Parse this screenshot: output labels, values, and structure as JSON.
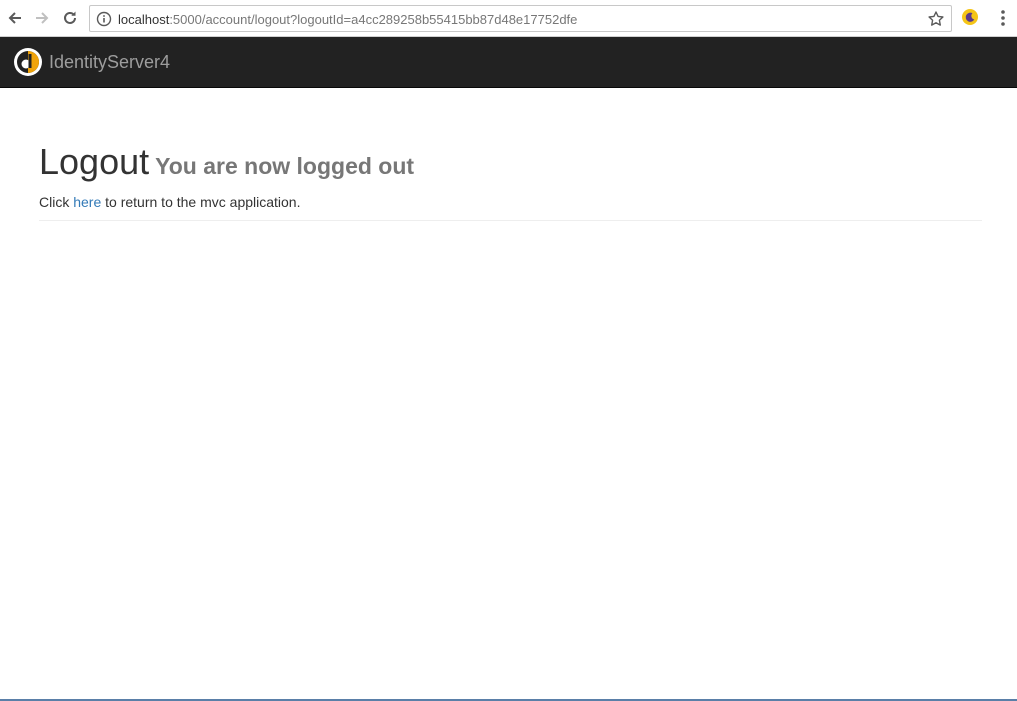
{
  "browser": {
    "url_host": "localhost",
    "url_path": ":5000/account/logout?logoutId=a4cc289258b55415bb87d48e17752dfe"
  },
  "navbar": {
    "brand": "IdentityServer4"
  },
  "page": {
    "title": "Logout",
    "subtitle": "You are now logged out",
    "message_prefix": "Click ",
    "link_text": "here",
    "message_suffix": " to return to the mvc application."
  },
  "colors": {
    "navbar_bg": "#222222",
    "brand_text": "#9d9d9d",
    "link": "#337ab7",
    "subtitle": "#777777"
  },
  "icons": {
    "back": "arrow-left-icon",
    "forward": "arrow-right-icon",
    "reload": "reload-icon",
    "info": "info-icon",
    "bookmark": "star-icon",
    "extension": "moon-icon",
    "menu": "kebab-menu-icon",
    "brand": "identityserver-logo"
  }
}
